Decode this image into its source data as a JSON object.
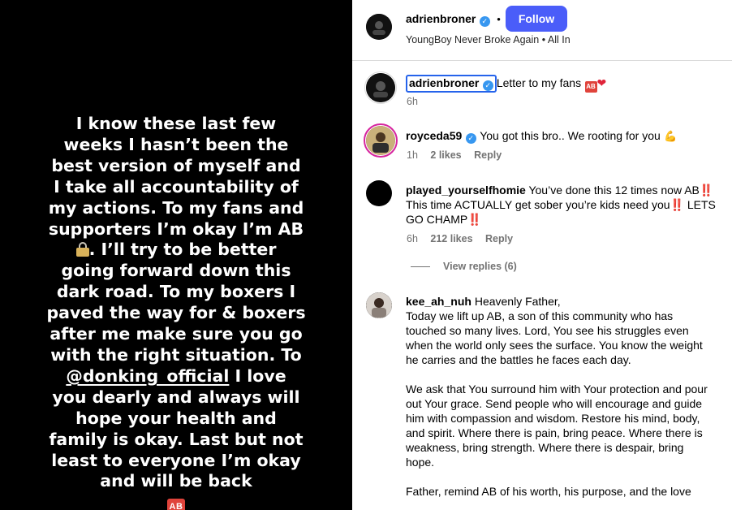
{
  "story": {
    "lines": [
      "I know these last few",
      "weeks I hasn’t been the",
      "best version of myself and",
      "I take all accountability of",
      "my actions. To my fans and",
      "supporters I’m okay I’m AB",
      ". I’ll try to be better",
      "going forward down this",
      "dark road. To my boxers I",
      "paved the way for & boxers",
      "after me make sure you go",
      "with the right situation. To",
      "@donking_official",
      " I love",
      "you dearly and always will",
      "hope your health and",
      "family is okay. Last but not",
      "least to everyone I’m okay",
      "and will be back"
    ],
    "badge": "AB",
    "lock_icon": "lock-icon"
  },
  "header": {
    "username": "adrienbroner",
    "separator": "•",
    "follow_label": "Follow",
    "audio": "YoungBoy Never Broke Again • All In"
  },
  "caption": {
    "username": "adrienbroner",
    "text": "Letter to my fans",
    "badge": "AB",
    "time": "6h"
  },
  "comments": [
    {
      "username": "royceda59",
      "text": "You got this bro.. We rooting for you",
      "time": "1h",
      "likes": "2 likes",
      "reply": "Reply"
    },
    {
      "username": "played_yourselfhomie",
      "text_1": "You’ve done this 12 times now AB",
      "text_2": "This time ACTUALLY get sober you’re kids need you",
      "text_3": " LETS",
      "text_4": "GO CHAMP",
      "bang": "‼️",
      "time": "6h",
      "likes": "212 likes",
      "reply": "Reply",
      "view_replies": "View replies (6)"
    },
    {
      "username": "kee_ah_nuh",
      "lines": [
        "Heavenly Father,",
        "Today we lift up AB, a son of this community who has",
        "touched so many lives. Lord, You see his struggles even",
        "when the world only sees the surface. You know the weight",
        "he carries and the battles he faces each day.",
        "",
        "We ask that You surround him with Your protection and pour",
        "out Your grace. Send people who will encourage and guide",
        "him with compassion and wisdom. Restore his mind, body,",
        "and spirit. Where there is pain, bring peace. Where there is",
        "weakness, bring strength. Where there is despair, bring",
        "hope.",
        "",
        "Father, remind AB of his worth, his purpose, and the love"
      ]
    }
  ],
  "colors": {
    "follow": "#4a5df9",
    "verified": "#3797f0",
    "meta": "#737373"
  }
}
